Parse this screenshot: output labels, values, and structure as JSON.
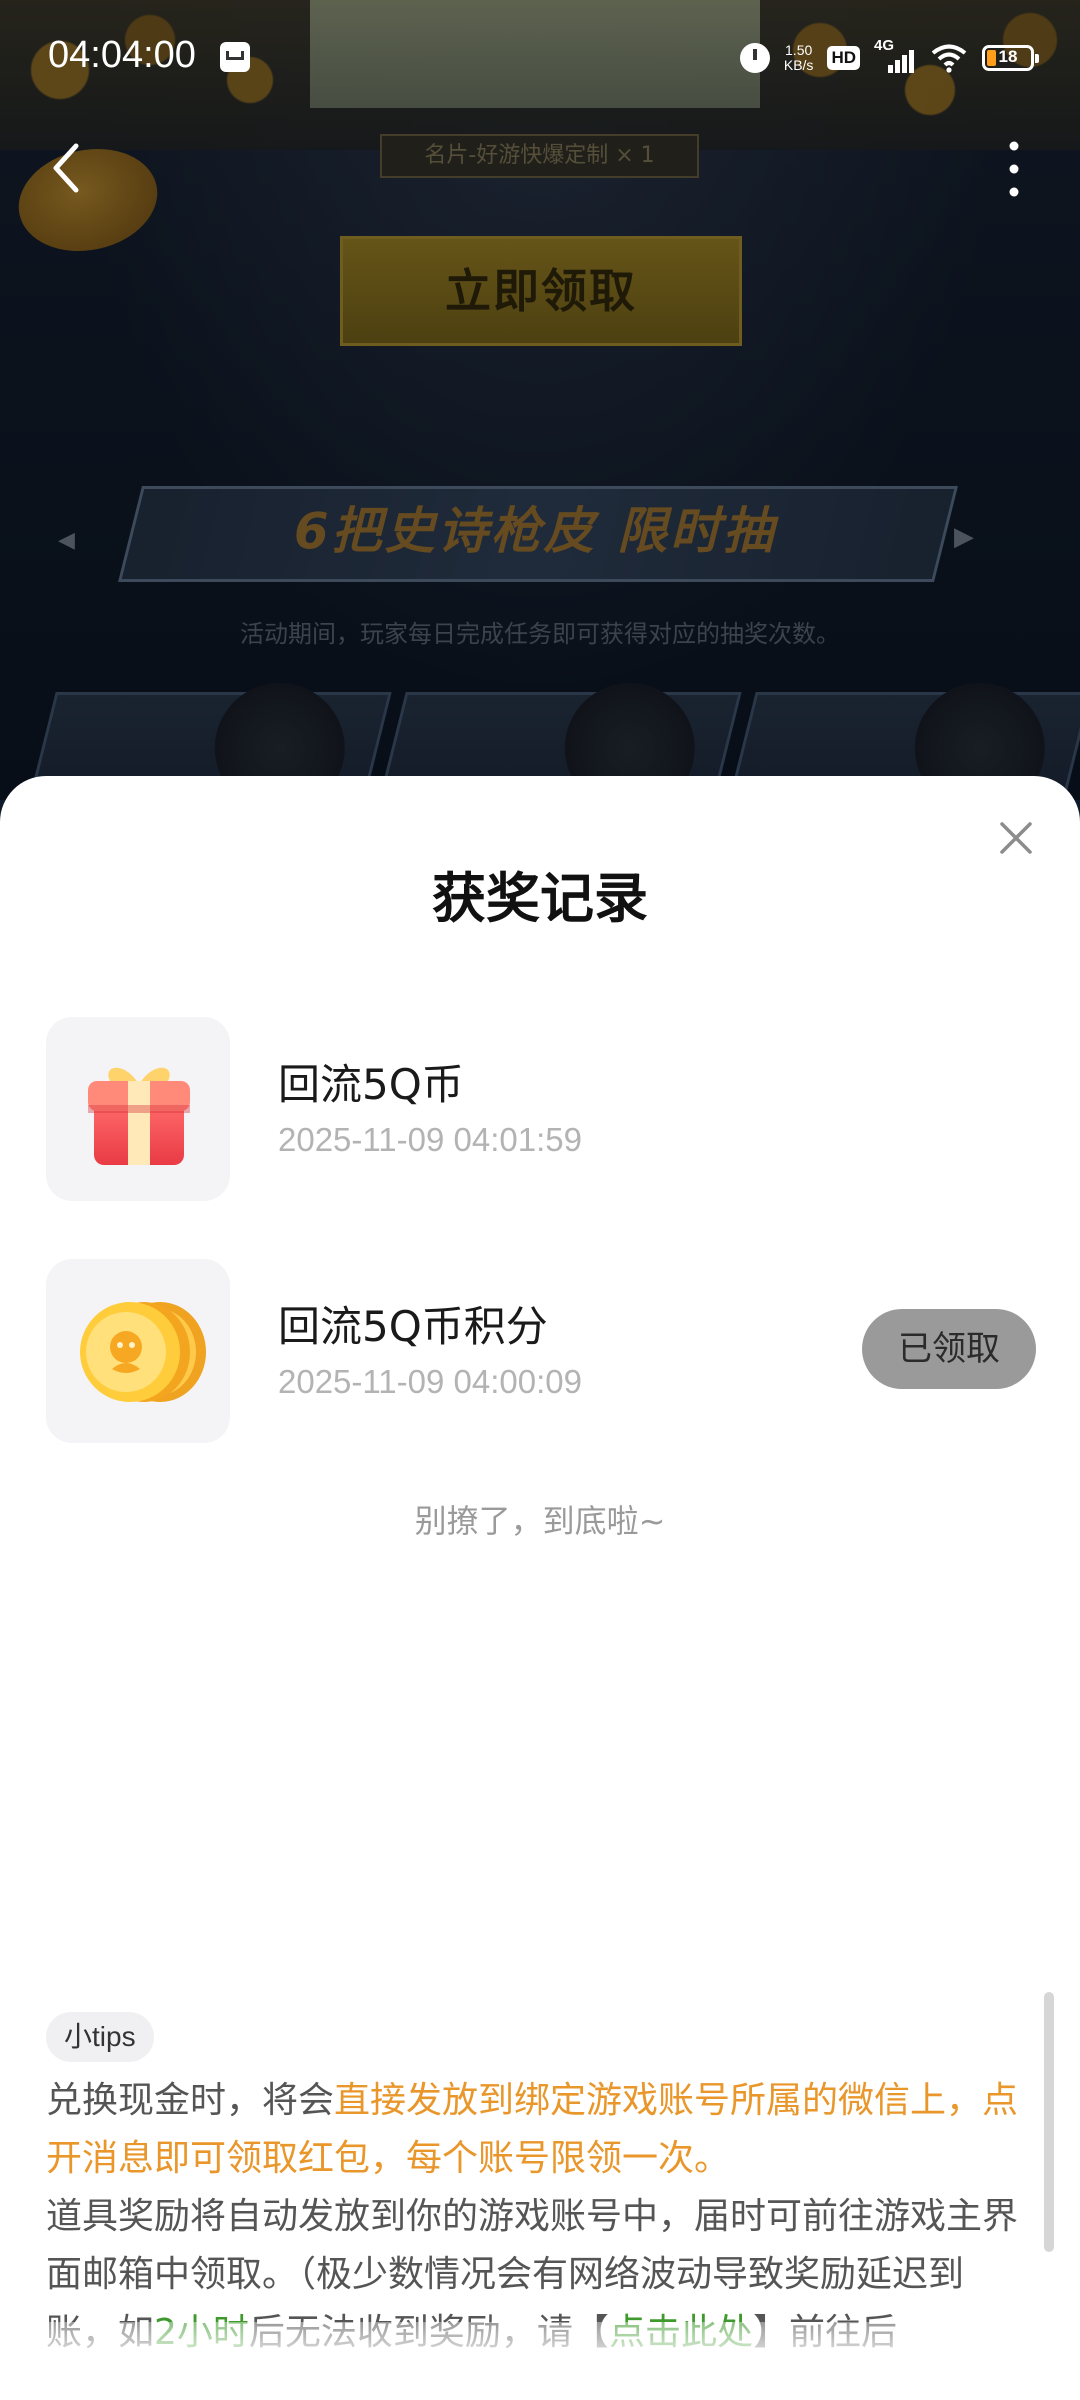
{
  "status_bar": {
    "time": "04:04:00",
    "net_speed_value": "1.50",
    "net_speed_unit": "KB/s",
    "hd_label": "HD",
    "network_type": "4G",
    "battery_level": "18",
    "accent_battery": "#ff9e1b"
  },
  "background_page": {
    "card_label": "名片-好游快爆定制 × 1",
    "claim_button": "立即领取",
    "banner_title": "6把史诗枪皮 限时抽",
    "activity_note": "活动期间，玩家每日完成任务即可获得对应的抽奖次数。"
  },
  "sheet": {
    "title": "获奖记录",
    "records": [
      {
        "name": "回流5Q币",
        "time": "2025-11-09 04:01:59",
        "icon": "gift-icon",
        "status": ""
      },
      {
        "name": "回流5Q币积分",
        "time": "2025-11-09 04:00:09",
        "icon": "q-coins-icon",
        "status": "已领取"
      }
    ],
    "end_text": "别撩了，到底啦~",
    "tips": {
      "badge": "小tips",
      "line1_prefix": "兑换现金时，将会",
      "line1_highlight": "直接发放到绑定游戏账号所属的微信上，点开消息即可领取红包，每个账号限领一次。",
      "line2_prefix": "道具奖励将自动发放到你的游戏账号中，届时可前往游戏主界面邮箱中领取。（极少数情况会有网络波动导致奖励延迟到账，如",
      "line2_green": "2小时",
      "line2_mid": "后无法收到奖励，请【",
      "line2_link": "点击此处",
      "line2_suffix": "】前往后"
    },
    "colors": {
      "highlight": "#e9962a",
      "link": "#3f9a2e"
    }
  }
}
